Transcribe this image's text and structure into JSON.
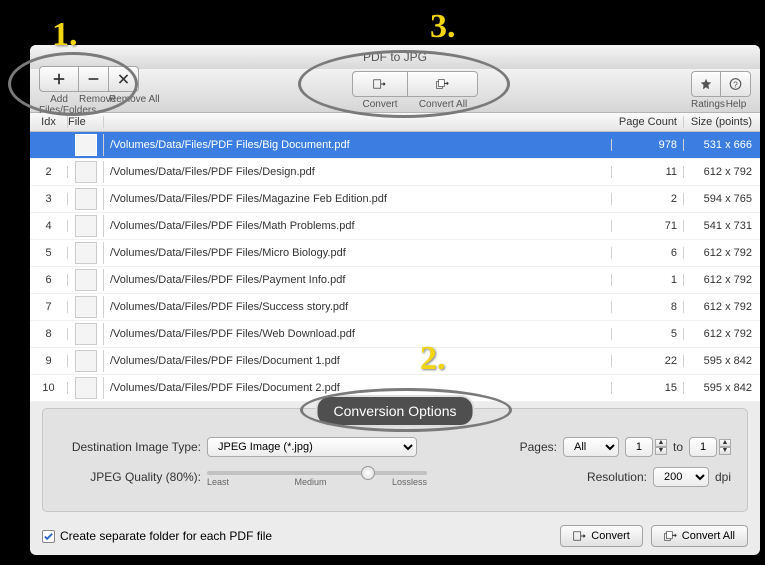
{
  "window": {
    "title": "PDF to JPG"
  },
  "toolbar": {
    "add": "Add Files/Folders",
    "remove": "Remove",
    "remove_all": "Remove All",
    "convert": "Convert",
    "convert_all": "Convert All",
    "ratings": "Ratings",
    "help": "Help"
  },
  "columns": {
    "idx": "Idx",
    "file": "File",
    "path": "",
    "pages": "Page Count",
    "size": "Size (points)"
  },
  "rows": [
    {
      "idx": "",
      "path": "/Volumes/Data/Files/PDF Files/Big Document.pdf",
      "pages": "978",
      "size": "531 x 666",
      "selected": true
    },
    {
      "idx": "2",
      "path": "/Volumes/Data/Files/PDF Files/Design.pdf",
      "pages": "11",
      "size": "612 x 792"
    },
    {
      "idx": "3",
      "path": "/Volumes/Data/Files/PDF Files/Magazine Feb Edition.pdf",
      "pages": "2",
      "size": "594 x 765"
    },
    {
      "idx": "4",
      "path": "/Volumes/Data/Files/PDF Files/Math Problems.pdf",
      "pages": "71",
      "size": "541 x 731"
    },
    {
      "idx": "5",
      "path": "/Volumes/Data/Files/PDF Files/Micro Biology.pdf",
      "pages": "6",
      "size": "612 x 792"
    },
    {
      "idx": "6",
      "path": "/Volumes/Data/Files/PDF Files/Payment Info.pdf",
      "pages": "1",
      "size": "612 x 792"
    },
    {
      "idx": "7",
      "path": "/Volumes/Data/Files/PDF Files/Success story.pdf",
      "pages": "8",
      "size": "612 x 792"
    },
    {
      "idx": "8",
      "path": "/Volumes/Data/Files/PDF Files/Web Download.pdf",
      "pages": "5",
      "size": "612 x 792"
    },
    {
      "idx": "9",
      "path": "/Volumes/Data/Files/PDF Files/Document 1.pdf",
      "pages": "22",
      "size": "595 x 842"
    },
    {
      "idx": "10",
      "path": "/Volumes/Data/Files/PDF Files/Document 2.pdf",
      "pages": "15",
      "size": "595 x 842"
    }
  ],
  "panel": {
    "title": "Conversion Options",
    "dest_label": "Destination Image Type:",
    "dest_value": "JPEG Image (*.jpg)",
    "pages_label": "Pages:",
    "pages_value": "All",
    "pages_from": "1",
    "pages_to_label": "to",
    "pages_to": "1",
    "quality_label": "JPEG Quality (80%):",
    "quality_least": "Least",
    "quality_medium": "Medium",
    "quality_lossless": "Lossless",
    "quality_pct": 80,
    "res_label": "Resolution:",
    "res_value": "200",
    "res_unit": "dpi"
  },
  "footer": {
    "checkbox_label": "Create separate folder for each PDF file",
    "convert": "Convert",
    "convert_all": "Convert All"
  },
  "annotations": {
    "one": "1.",
    "two": "2.",
    "three": "3."
  }
}
